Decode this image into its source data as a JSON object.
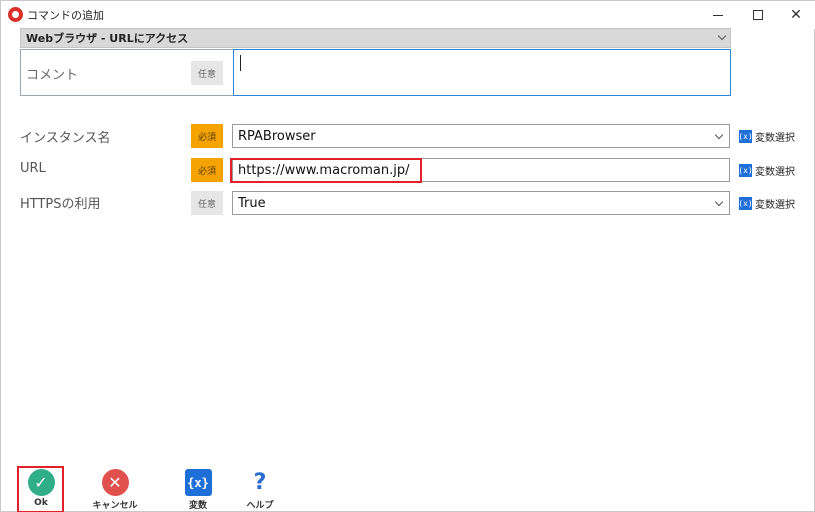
{
  "window": {
    "title": "コマンドの追加",
    "minimize_icon": "minimize-icon",
    "maximize_icon": "maximize-icon",
    "close_glyph": "✕"
  },
  "command": {
    "selected": "Webブラウザ - URLにアクセス"
  },
  "comment": {
    "label": "コメント",
    "badge": "任意",
    "value": ""
  },
  "rows": [
    {
      "label": "インスタンス名",
      "badge": "必須",
      "badge_type": "required",
      "value": "RPABrowser",
      "control": "select"
    },
    {
      "label": "URL",
      "badge": "必須",
      "badge_type": "required",
      "value": "https://www.macroman.jp/",
      "control": "text"
    },
    {
      "label": "HTTPSの利用",
      "badge": "任意",
      "badge_type": "optional",
      "value": "True",
      "control": "select"
    }
  ],
  "var_select": {
    "icon_text": "(x)",
    "label": "変数選択"
  },
  "footer": {
    "ok": {
      "label": "Ok",
      "glyph": "✓"
    },
    "cancel": {
      "label": "キャンセル",
      "glyph": "✕"
    },
    "variables": {
      "label": "変数",
      "glyph": "{x}"
    },
    "help": {
      "label": "ヘルプ",
      "glyph": "?"
    }
  },
  "colors": {
    "required_badge": "#f5a300",
    "optional_badge": "#e6e6e6",
    "highlight": "#e0202a",
    "ok": "#2fae87",
    "cancel": "#e0504c",
    "accent": "#1e6fd8"
  }
}
